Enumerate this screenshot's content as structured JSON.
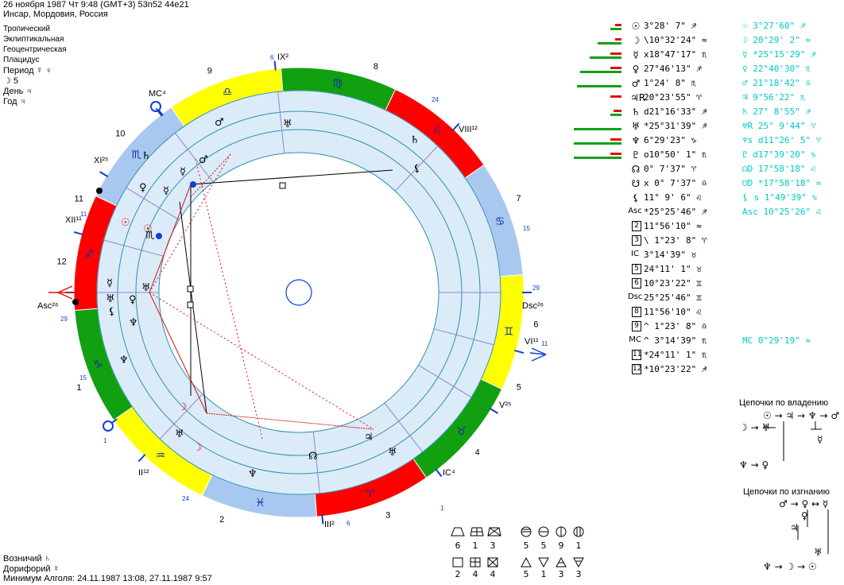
{
  "header": {
    "line1": "26 ноября 1987  Чт  9:48 (GMT+3) 53n52  44e21",
    "line2": "Инсар, Мордовия, Россия",
    "opt1": "Тропический",
    "opt2": "Эклиптикальная",
    "opt3": "Геоцентрическая",
    "opt4": "Плацидус",
    "period": "Период  ☿ ♀",
    "moon": "☽  5",
    "day": "День  ♃",
    "year": "Год  ♃"
  },
  "planets": [
    {
      "sym": "☉",
      "val": "   3°28'  7\" ♐",
      "val2": "☉   3°27'60\" ♐",
      "green": 14,
      "red": 8
    },
    {
      "sym": "☽",
      "val": "\\10°32'24\" ≈",
      "val2": "☽  20°29'  2\" ≈",
      "green": 30,
      "red": 8
    },
    {
      "sym": "☿",
      "val": "x18°47'17\" ♏",
      "val2": "☿ *25°15'29\" ♐",
      "green": 40,
      "red": 14
    },
    {
      "sym": "♀",
      "val": "  27°46'13\" ♐",
      "val2": "♀  22°40'30\" ♏",
      "green": 52,
      "red": 14
    },
    {
      "sym": "♂",
      "val": "   1°24'  8\" ♏",
      "val2": "♂  21°18'42\" ♎",
      "green": 56,
      "red": 0
    },
    {
      "sym": "♃R",
      "val": " 20°23'55\" ♈",
      "val2": "♃   9°56'22\" ♏",
      "green": 0,
      "red": 14
    },
    {
      "sym": "♄",
      "val": "d21°16'33\" ♐",
      "val2": "♄  27° 8'55\" ♐",
      "green": 14,
      "red": 10
    },
    {
      "sym": "♅",
      "val": "*25°31'39\" ♐",
      "val2": "♅R 25° 9'44\" ♈",
      "green": 60,
      "red": 0
    },
    {
      "sym": "♆",
      "val": "   6°29'23\" ♑",
      "val2": "♆s d11°26' 5\" ♈",
      "green": 60,
      "red": 14
    },
    {
      "sym": "♇",
      "val": "o10°50'  1\" ♏",
      "val2": "♇ d17°39'20\" ♑",
      "green": 60,
      "red": 14
    },
    {
      "sym": "☊",
      "val": "   0° 7'37\" ♈",
      "val2": "☊D 17°58'18\" ♌",
      "green": 0,
      "red": 0
    },
    {
      "sym": "☋",
      "val": "x 0° 7'37\" ♎",
      "val2": "☋D *17°58'18\" ≈",
      "green": 0,
      "red": 0
    },
    {
      "sym": "⚸",
      "val": "  11° 9' 6\" ♌",
      "val2": "⚸ s  1°49'39\" ♑",
      "green": 0,
      "red": 0
    },
    {
      "sym": "Asc",
      "val": "*25°25'46\" ♐",
      "val2": "Asc  10°25'26\" ♌",
      "green": 0,
      "red": 0
    },
    {
      "sym": "2",
      "val": "  11°56'10\" ≈",
      "val2": "",
      "green": 0,
      "red": 0
    },
    {
      "sym": "3",
      "val": "\\  1°23'  8\" ♈",
      "val2": "",
      "green": 0,
      "red": 0
    },
    {
      "sym": "IC",
      "val": "   3°14'39\" ♉",
      "val2": "",
      "green": 0,
      "red": 0
    },
    {
      "sym": "5",
      "val": "  24°11'  1\" ♉",
      "val2": "",
      "green": 0,
      "red": 0
    },
    {
      "sym": "6",
      "val": "  10°23'22\" ♊",
      "val2": "",
      "green": 0,
      "red": 0
    },
    {
      "sym": "Dsc",
      "val": "  25°25'46\" ♊",
      "val2": "",
      "green": 0,
      "red": 0
    },
    {
      "sym": "8",
      "val": "  11°56'10\" ♌",
      "val2": "",
      "green": 0,
      "red": 0
    },
    {
      "sym": "9",
      "val": "^  1°23'  8\" ♎",
      "val2": "",
      "green": 0,
      "red": 0
    },
    {
      "sym": "MC",
      "val": "^  3°14'39\" ♏",
      "val2": "MC   0°29'19\" ≈",
      "green": 0,
      "red": 0
    },
    {
      "sym": "11",
      "val": "*24°11'  1\" ♏",
      "val2": "",
      "green": 0,
      "red": 0
    },
    {
      "sym": "12",
      "val": "*10°23'22\" ♐",
      "val2": "",
      "green": 0,
      "red": 0
    }
  ],
  "chains": {
    "title1": "Цепочки по владению",
    "c1": [
      "☉ → ♃ → ♆ → ♂",
      "☽ → ♅",
      "☿",
      "♆ → ♀"
    ],
    "title2": "Цепочки по изгнанию",
    "c2": [
      "♂ → ♀ ↔ ☿",
      "♀",
      "♃",
      "♅",
      "♆ → ☽ → ☉"
    ]
  },
  "footer": {
    "vozn": "Возничий  ♄",
    "dorif": "Дорифорий  ☿",
    "algol": "Минимум Алголя: 24.11.1987 13:08,  27.11.1987  9:57"
  },
  "aspects": {
    "row1": [
      "6",
      "1",
      "3",
      "5",
      "5",
      "9",
      "1"
    ],
    "row2": [
      "2",
      "4",
      "4",
      "5",
      "1",
      "3",
      "3"
    ]
  },
  "colors": {
    "green": "#14a014",
    "red": "#e01010",
    "cyan": "#00c8c8",
    "blue": "#1040d0",
    "zodiacYellow": "#ffff00",
    "zodiacBlue": "#a8c8f0",
    "zodiacRed": "#ff0000",
    "zodiacGreen": "#10a010"
  },
  "wheel": {
    "signs": [
      "♐",
      "♏",
      "♎",
      "♍",
      "♌",
      "♋",
      "♊",
      "♉",
      "♈",
      "♓",
      "♒",
      "♑"
    ],
    "houseNums": [
      "1",
      "2",
      "3",
      "4",
      "5",
      "6",
      "7",
      "8",
      "9",
      "10",
      "11",
      "12"
    ],
    "labels": {
      "asc": "Asc",
      "dsc": "Dsc",
      "mc": "MC",
      "ic": "IC",
      "ix": "IX",
      "viii": "VIII",
      "vi": "VI",
      "v": "V",
      "iii": "III",
      "ii": "II",
      "xi": "XI",
      "xii": "XII"
    },
    "ticks": [
      "6",
      "24",
      "15",
      "29",
      "11",
      "1",
      "6",
      "24",
      "15",
      "29",
      "1",
      "11"
    ]
  }
}
